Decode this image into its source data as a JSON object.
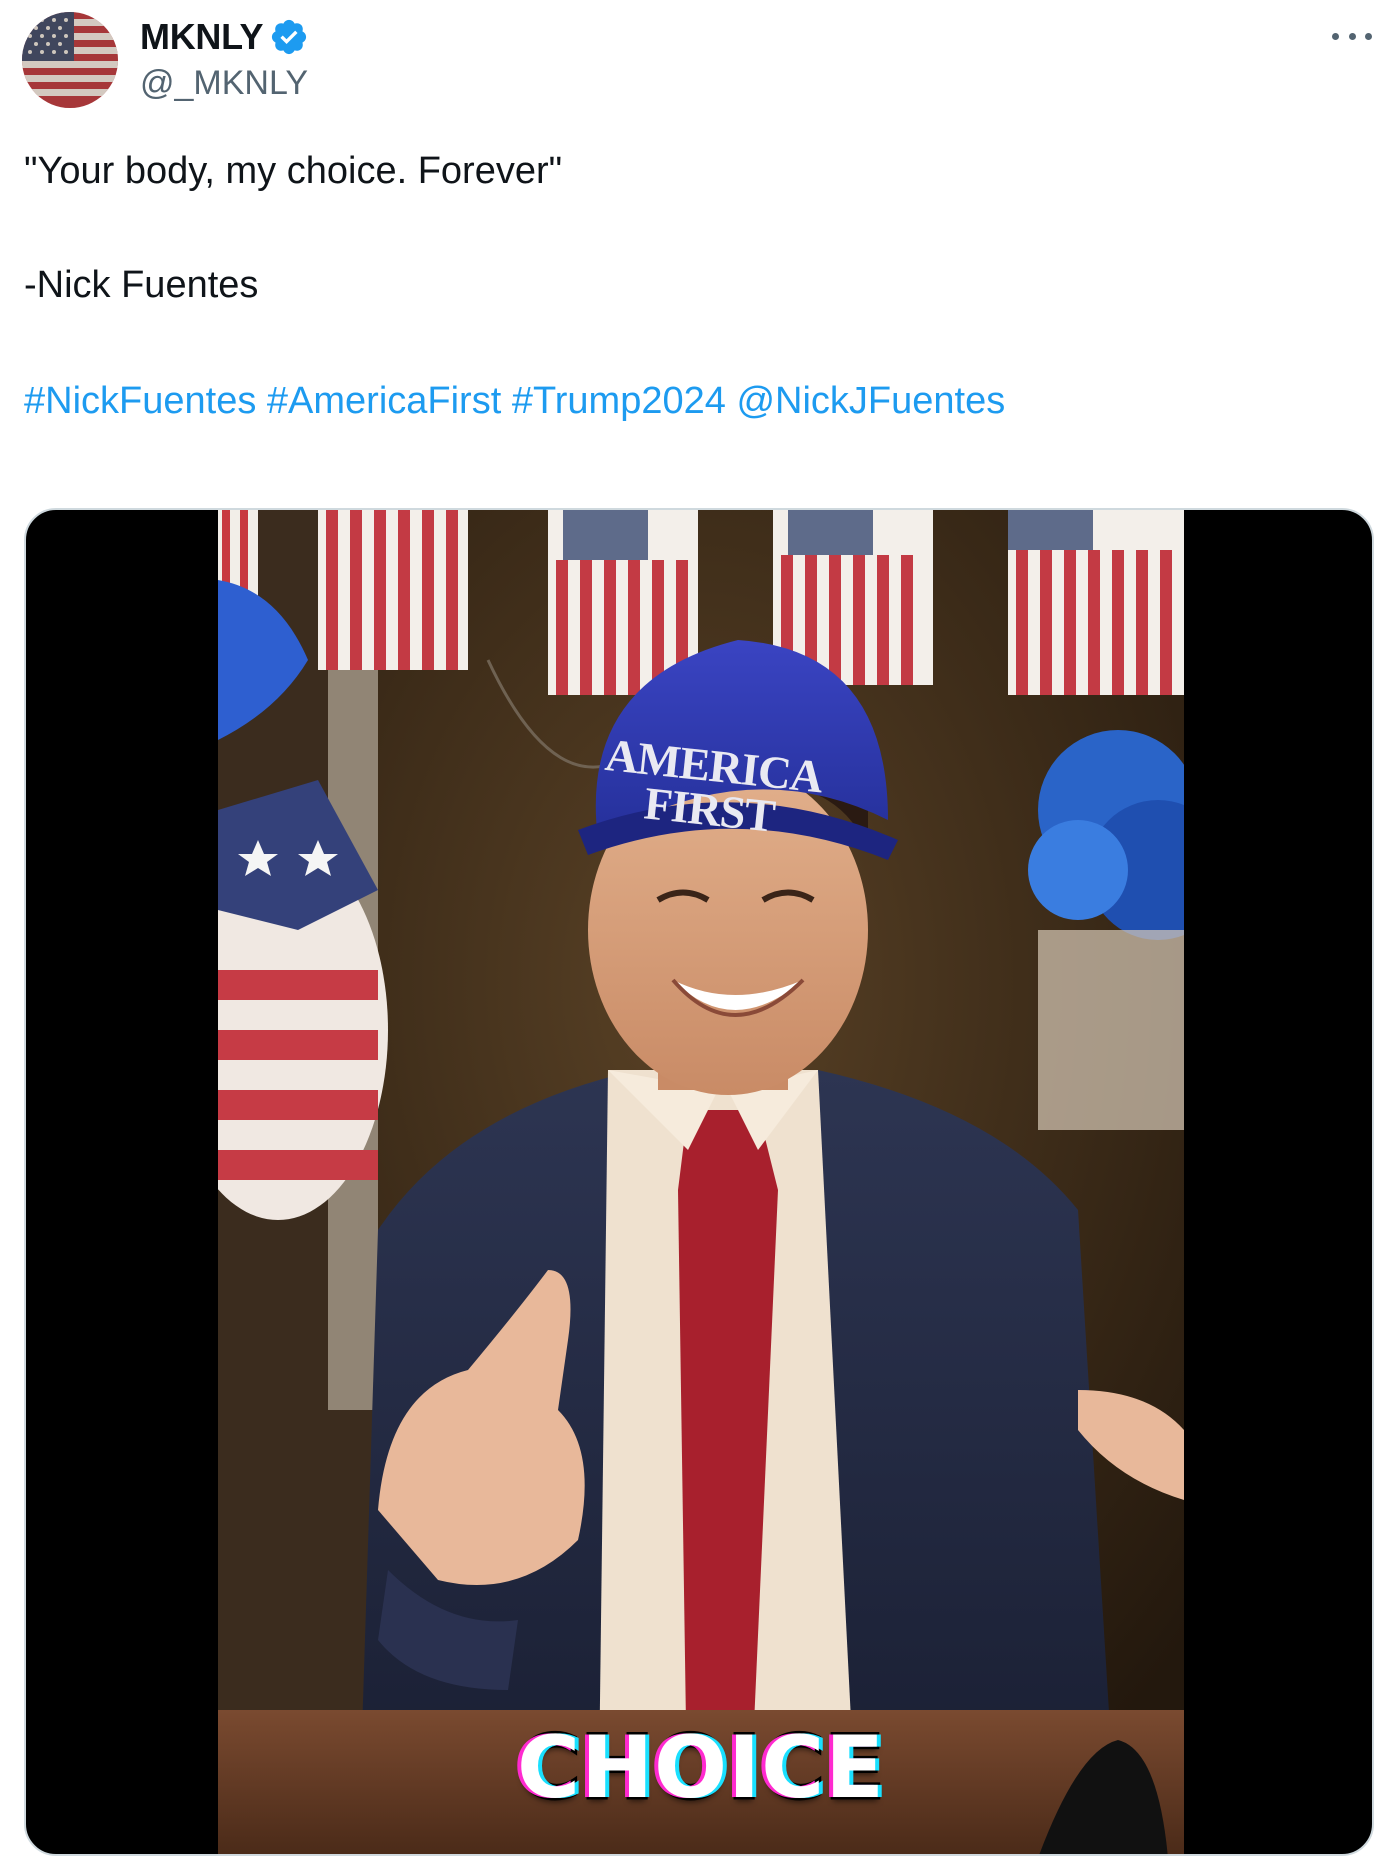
{
  "author": {
    "display_name": "MKNLY",
    "handle": "@_MKNLY",
    "verified": true,
    "avatar_icon": "us-flag-avatar"
  },
  "tweet": {
    "line1": "\"Your body, my choice. Forever\"",
    "line2": "-Nick Fuentes",
    "tags": [
      "#NickFuentes",
      "#AmericaFirst",
      "#Trump2024",
      "@NickJFuentes"
    ]
  },
  "media": {
    "hat_line1": "AMERICA",
    "hat_line2": "FIRST",
    "caption": "CHOICE"
  },
  "colors": {
    "link": "#1d9bf0",
    "verified_badge": "#1d9bf0",
    "secondary_text": "#536471",
    "primary_text": "#0f1419"
  }
}
